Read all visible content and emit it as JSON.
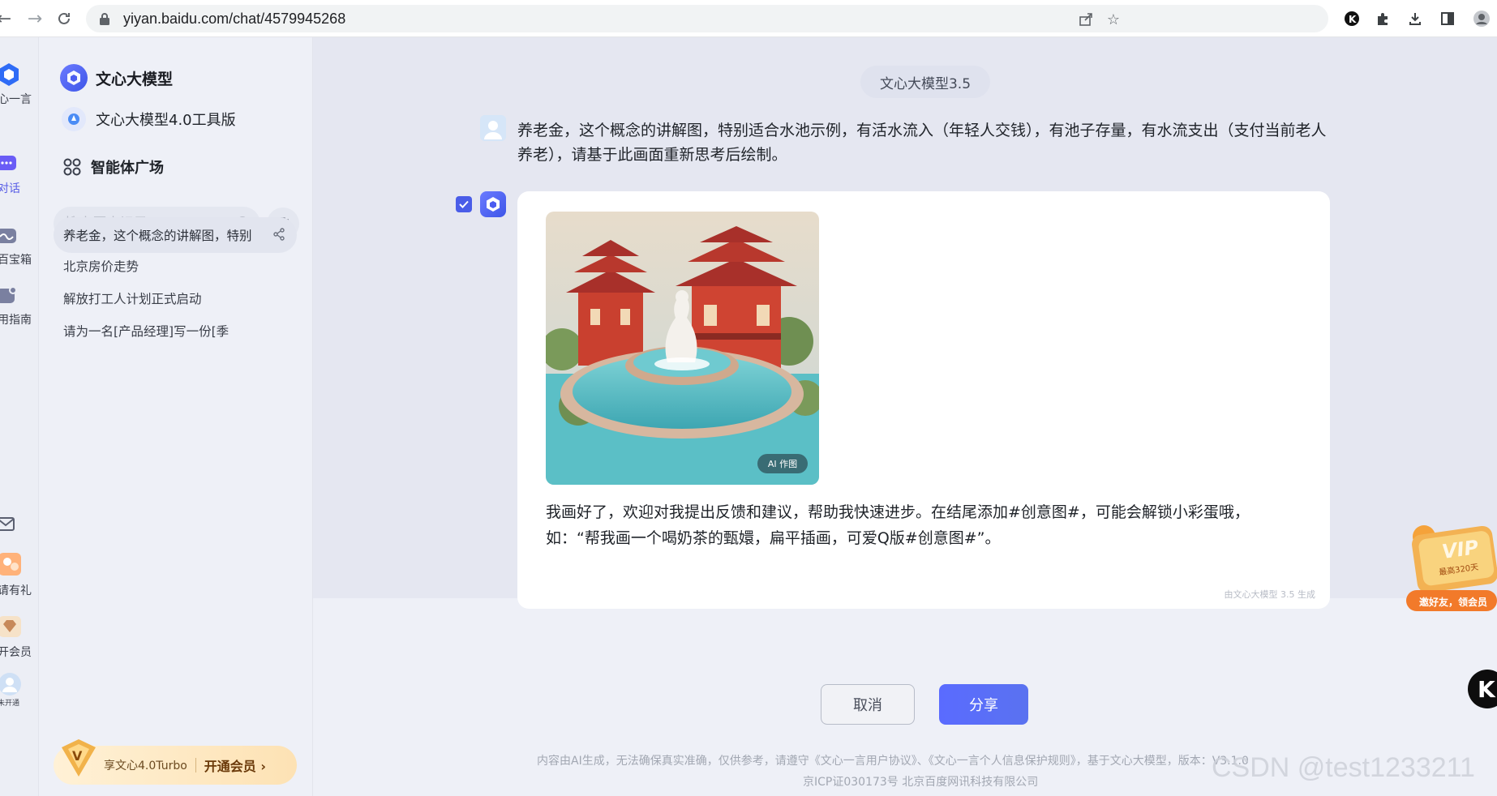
{
  "browser": {
    "url": "yiyan.baidu.com/chat/4579945268"
  },
  "rail": {
    "items": [
      {
        "label": "心一言",
        "icon": "yiyan-logo-icon"
      },
      {
        "label": "对话",
        "icon": "chat-icon"
      },
      {
        "label": "百宝箱",
        "icon": "toolbox-icon"
      },
      {
        "label": "用指南",
        "icon": "guide-icon"
      },
      {
        "label": "",
        "icon": "mail-icon"
      },
      {
        "label": "请有礼",
        "icon": "invite-icon"
      },
      {
        "label": "开会员",
        "icon": "vip-diamond-icon"
      },
      {
        "label": "未开通",
        "icon": "user-avatar-icon"
      }
    ]
  },
  "sidebar": {
    "brand": "文心大模型",
    "tool": "文心大模型4.0工具版",
    "plaza": "智能体广场",
    "search_placeholder": "搜索历史记录",
    "history": [
      "养老金，这个概念的讲解图，特别",
      "北京房价走势",
      "解放打工人计划正式启动",
      "请为一名[产品经理]写一份[季"
    ],
    "promo": {
      "text": "享文心4.0Turbo",
      "cta": "开通会员 ›"
    }
  },
  "main": {
    "model_label": "文心大模型3.5",
    "user_message": "养老金，这个概念的讲解图，特别适合水池示例，有活水流入（年轻人交钱），有池子存量，有水流支出（支付当前老人养老），请基于此画面重新思考后绘制。",
    "image_badge": "AI 作图",
    "bot_message": "我画好了，欢迎对我提出反馈和建议，帮助我快速进步。在结尾添加#创意图#，可能会解锁小彩蛋哦，如：“帮我画一个喝奶茶的甄嬛，扁平插画，可爱Q版#创意图#”。",
    "generated_note": "由文心大模型 3.5 生成",
    "cancel_label": "取消",
    "share_label": "分享",
    "footer_line1": "内容由AI生成，无法确保真实准确，仅供参考，请遵守《文心一言用户协议》、《文心一言个人信息保护规则》，基于文心大模型，版本：V3.1.0",
    "footer_line2": "京ICP证030173号 北京百度网讯科技有限公司",
    "watermark": "CSDN @test1233211"
  },
  "floating": {
    "vip_title": "VIP",
    "vip_days": "最高320天",
    "vip_cta": "邀好友，领会员",
    "k_label": "K"
  },
  "colors": {
    "accent": "#4a5de8",
    "share_button": "#5a6bff",
    "page_bg": "#eef0f7",
    "promo_gold": "#fde2b4"
  }
}
